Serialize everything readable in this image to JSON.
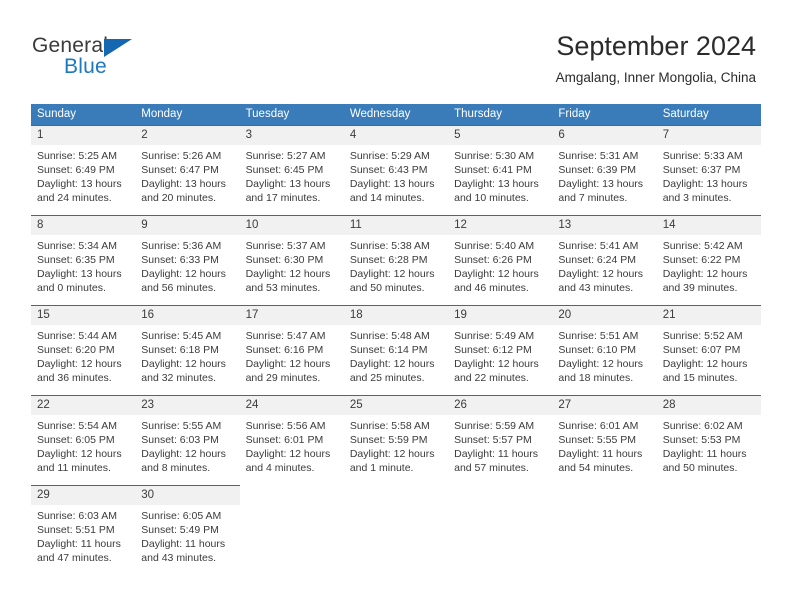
{
  "brand": {
    "name_top": "General",
    "name_bottom": "Blue",
    "triangle_icon": "triangle-icon",
    "accent_color": "#1667b2"
  },
  "header": {
    "title": "September 2024",
    "subtitle": "Amgalang, Inner Mongolia, China"
  },
  "colors": {
    "header_band": "#3a7cba",
    "daynum_band": "#f1f1f1",
    "separator": "#2c6daf",
    "text": "#3b3b3b"
  },
  "weekday_headers": [
    "Sunday",
    "Monday",
    "Tuesday",
    "Wednesday",
    "Thursday",
    "Friday",
    "Saturday"
  ],
  "weeks": [
    [
      {
        "day": "1",
        "sunrise": "Sunrise: 5:25 AM",
        "sunset": "Sunset: 6:49 PM",
        "daylight_1": "Daylight: 13 hours",
        "daylight_2": "and 24 minutes."
      },
      {
        "day": "2",
        "sunrise": "Sunrise: 5:26 AM",
        "sunset": "Sunset: 6:47 PM",
        "daylight_1": "Daylight: 13 hours",
        "daylight_2": "and 20 minutes."
      },
      {
        "day": "3",
        "sunrise": "Sunrise: 5:27 AM",
        "sunset": "Sunset: 6:45 PM",
        "daylight_1": "Daylight: 13 hours",
        "daylight_2": "and 17 minutes."
      },
      {
        "day": "4",
        "sunrise": "Sunrise: 5:29 AM",
        "sunset": "Sunset: 6:43 PM",
        "daylight_1": "Daylight: 13 hours",
        "daylight_2": "and 14 minutes."
      },
      {
        "day": "5",
        "sunrise": "Sunrise: 5:30 AM",
        "sunset": "Sunset: 6:41 PM",
        "daylight_1": "Daylight: 13 hours",
        "daylight_2": "and 10 minutes."
      },
      {
        "day": "6",
        "sunrise": "Sunrise: 5:31 AM",
        "sunset": "Sunset: 6:39 PM",
        "daylight_1": "Daylight: 13 hours",
        "daylight_2": "and 7 minutes."
      },
      {
        "day": "7",
        "sunrise": "Sunrise: 5:33 AM",
        "sunset": "Sunset: 6:37 PM",
        "daylight_1": "Daylight: 13 hours",
        "daylight_2": "and 3 minutes."
      }
    ],
    [
      {
        "day": "8",
        "sunrise": "Sunrise: 5:34 AM",
        "sunset": "Sunset: 6:35 PM",
        "daylight_1": "Daylight: 13 hours",
        "daylight_2": "and 0 minutes."
      },
      {
        "day": "9",
        "sunrise": "Sunrise: 5:36 AM",
        "sunset": "Sunset: 6:33 PM",
        "daylight_1": "Daylight: 12 hours",
        "daylight_2": "and 56 minutes."
      },
      {
        "day": "10",
        "sunrise": "Sunrise: 5:37 AM",
        "sunset": "Sunset: 6:30 PM",
        "daylight_1": "Daylight: 12 hours",
        "daylight_2": "and 53 minutes."
      },
      {
        "day": "11",
        "sunrise": "Sunrise: 5:38 AM",
        "sunset": "Sunset: 6:28 PM",
        "daylight_1": "Daylight: 12 hours",
        "daylight_2": "and 50 minutes."
      },
      {
        "day": "12",
        "sunrise": "Sunrise: 5:40 AM",
        "sunset": "Sunset: 6:26 PM",
        "daylight_1": "Daylight: 12 hours",
        "daylight_2": "and 46 minutes."
      },
      {
        "day": "13",
        "sunrise": "Sunrise: 5:41 AM",
        "sunset": "Sunset: 6:24 PM",
        "daylight_1": "Daylight: 12 hours",
        "daylight_2": "and 43 minutes."
      },
      {
        "day": "14",
        "sunrise": "Sunrise: 5:42 AM",
        "sunset": "Sunset: 6:22 PM",
        "daylight_1": "Daylight: 12 hours",
        "daylight_2": "and 39 minutes."
      }
    ],
    [
      {
        "day": "15",
        "sunrise": "Sunrise: 5:44 AM",
        "sunset": "Sunset: 6:20 PM",
        "daylight_1": "Daylight: 12 hours",
        "daylight_2": "and 36 minutes."
      },
      {
        "day": "16",
        "sunrise": "Sunrise: 5:45 AM",
        "sunset": "Sunset: 6:18 PM",
        "daylight_1": "Daylight: 12 hours",
        "daylight_2": "and 32 minutes."
      },
      {
        "day": "17",
        "sunrise": "Sunrise: 5:47 AM",
        "sunset": "Sunset: 6:16 PM",
        "daylight_1": "Daylight: 12 hours",
        "daylight_2": "and 29 minutes."
      },
      {
        "day": "18",
        "sunrise": "Sunrise: 5:48 AM",
        "sunset": "Sunset: 6:14 PM",
        "daylight_1": "Daylight: 12 hours",
        "daylight_2": "and 25 minutes."
      },
      {
        "day": "19",
        "sunrise": "Sunrise: 5:49 AM",
        "sunset": "Sunset: 6:12 PM",
        "daylight_1": "Daylight: 12 hours",
        "daylight_2": "and 22 minutes."
      },
      {
        "day": "20",
        "sunrise": "Sunrise: 5:51 AM",
        "sunset": "Sunset: 6:10 PM",
        "daylight_1": "Daylight: 12 hours",
        "daylight_2": "and 18 minutes."
      },
      {
        "day": "21",
        "sunrise": "Sunrise: 5:52 AM",
        "sunset": "Sunset: 6:07 PM",
        "daylight_1": "Daylight: 12 hours",
        "daylight_2": "and 15 minutes."
      }
    ],
    [
      {
        "day": "22",
        "sunrise": "Sunrise: 5:54 AM",
        "sunset": "Sunset: 6:05 PM",
        "daylight_1": "Daylight: 12 hours",
        "daylight_2": "and 11 minutes."
      },
      {
        "day": "23",
        "sunrise": "Sunrise: 5:55 AM",
        "sunset": "Sunset: 6:03 PM",
        "daylight_1": "Daylight: 12 hours",
        "daylight_2": "and 8 minutes."
      },
      {
        "day": "24",
        "sunrise": "Sunrise: 5:56 AM",
        "sunset": "Sunset: 6:01 PM",
        "daylight_1": "Daylight: 12 hours",
        "daylight_2": "and 4 minutes."
      },
      {
        "day": "25",
        "sunrise": "Sunrise: 5:58 AM",
        "sunset": "Sunset: 5:59 PM",
        "daylight_1": "Daylight: 12 hours",
        "daylight_2": "and 1 minute."
      },
      {
        "day": "26",
        "sunrise": "Sunrise: 5:59 AM",
        "sunset": "Sunset: 5:57 PM",
        "daylight_1": "Daylight: 11 hours",
        "daylight_2": "and 57 minutes."
      },
      {
        "day": "27",
        "sunrise": "Sunrise: 6:01 AM",
        "sunset": "Sunset: 5:55 PM",
        "daylight_1": "Daylight: 11 hours",
        "daylight_2": "and 54 minutes."
      },
      {
        "day": "28",
        "sunrise": "Sunrise: 6:02 AM",
        "sunset": "Sunset: 5:53 PM",
        "daylight_1": "Daylight: 11 hours",
        "daylight_2": "and 50 minutes."
      }
    ],
    [
      {
        "day": "29",
        "sunrise": "Sunrise: 6:03 AM",
        "sunset": "Sunset: 5:51 PM",
        "daylight_1": "Daylight: 11 hours",
        "daylight_2": "and 47 minutes."
      },
      {
        "day": "30",
        "sunrise": "Sunrise: 6:05 AM",
        "sunset": "Sunset: 5:49 PM",
        "daylight_1": "Daylight: 11 hours",
        "daylight_2": "and 43 minutes."
      },
      {
        "day": "",
        "sunrise": "",
        "sunset": "",
        "daylight_1": "",
        "daylight_2": ""
      },
      {
        "day": "",
        "sunrise": "",
        "sunset": "",
        "daylight_1": "",
        "daylight_2": ""
      },
      {
        "day": "",
        "sunrise": "",
        "sunset": "",
        "daylight_1": "",
        "daylight_2": ""
      },
      {
        "day": "",
        "sunrise": "",
        "sunset": "",
        "daylight_1": "",
        "daylight_2": ""
      },
      {
        "day": "",
        "sunrise": "",
        "sunset": "",
        "daylight_1": "",
        "daylight_2": ""
      }
    ]
  ]
}
